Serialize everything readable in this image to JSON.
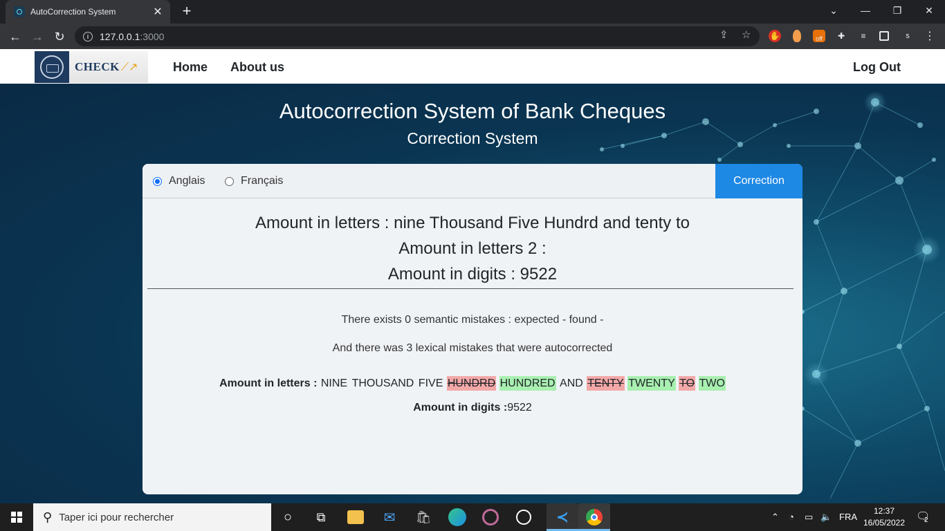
{
  "browser": {
    "tab_title": "AutoCorrection System",
    "tab_close": "✕",
    "new_tab": "+",
    "url_host": "127.0.0.1",
    "url_port": ":3000",
    "win_minimize": "—",
    "win_restore": "❐",
    "win_close": "✕",
    "win_dropdown": "⌄",
    "profile_letter": "s"
  },
  "navbar": {
    "logo_text": "CHECK",
    "links": [
      "Home",
      "About us"
    ],
    "logout": "Log Out"
  },
  "header": {
    "title": "Autocorrection System of Bank Cheques",
    "subtitle": "Correction System"
  },
  "card": {
    "languages": [
      {
        "label": "Anglais",
        "selected": true
      },
      {
        "label": "Français",
        "selected": false
      }
    ],
    "correction_button": "Correction",
    "amount_letters_line": "Amount in letters : nine Thousand Five Hundrd and tenty to",
    "amount_letters2_line": "Amount in letters 2 :",
    "amount_digits_line": "Amount in digits : 9522",
    "semantic_msg": "There exists 0 semantic mistakes : expected - found -",
    "lexical_msg": "And there was 3 lexical mistakes that were autocorrected",
    "result": {
      "letters_label": "Amount in letters :",
      "words": [
        {
          "text": "NINE",
          "status": "ok"
        },
        {
          "text": "THOUSAND",
          "status": "ok"
        },
        {
          "text": "FIVE",
          "status": "ok"
        },
        {
          "text": "HUNDRD",
          "status": "wrong"
        },
        {
          "text": "HUNDRED",
          "status": "corrected"
        },
        {
          "text": "AND",
          "status": "ok"
        },
        {
          "text": "TENTY",
          "status": "wrong"
        },
        {
          "text": "TWENTY",
          "status": "corrected"
        },
        {
          "text": "TO",
          "status": "wrong"
        },
        {
          "text": "TWO",
          "status": "corrected"
        }
      ],
      "digits_label": "Amount in digits :",
      "digits_value": "9522"
    }
  },
  "colors": {
    "wrong_bg": "#f3a8a8",
    "corrected_bg": "#a8efb0",
    "button_blue": "#1e88e5"
  },
  "taskbar": {
    "search_placeholder": "Taper ici pour rechercher",
    "language": "FRA",
    "time": "12:37",
    "date": "16/05/2022",
    "notification_count": "2"
  }
}
